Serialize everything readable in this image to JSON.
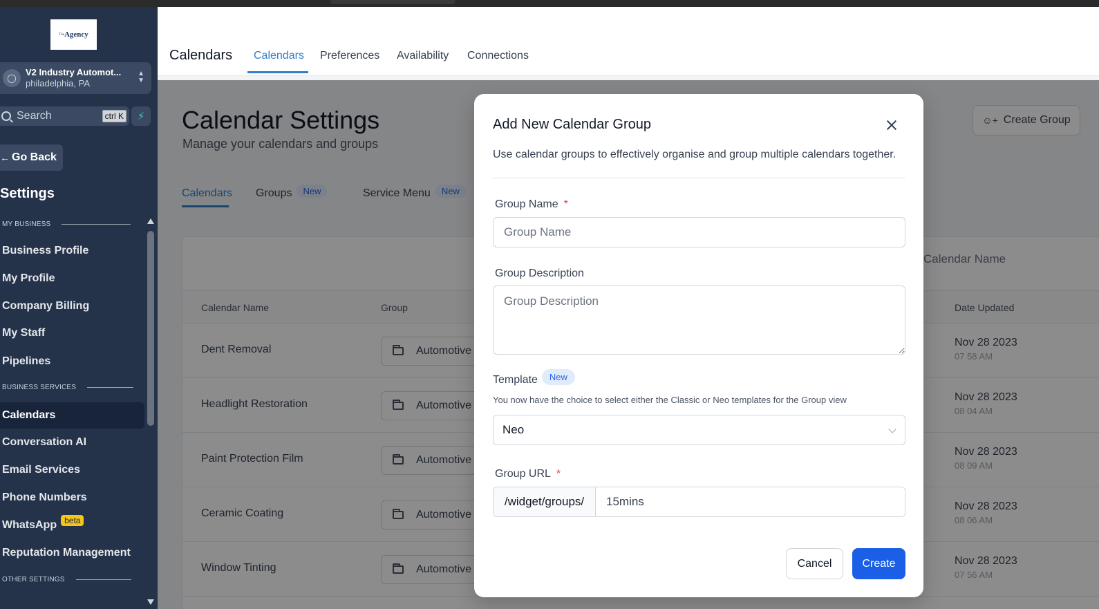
{
  "sidebar": {
    "logo_text": "Agency",
    "logo_super": "The",
    "location": {
      "name": "V2 Industry Automot...",
      "city": "philadelphia, PA"
    },
    "search": {
      "placeholder": "Search",
      "shortcut": "ctrl K"
    },
    "go_back": "Go Back",
    "title": "Settings",
    "sections": [
      {
        "label": "MY BUSINESS"
      },
      {
        "label": "BUSINESS SERVICES"
      },
      {
        "label": "OTHER SETTINGS"
      }
    ],
    "items": [
      {
        "label": "Business Profile"
      },
      {
        "label": "My Profile"
      },
      {
        "label": "Company Billing"
      },
      {
        "label": "My Staff"
      },
      {
        "label": "Pipelines"
      },
      {
        "label": "Calendars",
        "active": true
      },
      {
        "label": "Conversation AI"
      },
      {
        "label": "Email Services"
      },
      {
        "label": "Phone Numbers"
      },
      {
        "label": "WhatsApp",
        "badge": "beta"
      },
      {
        "label": "Reputation Management"
      }
    ]
  },
  "topbar": {
    "title": "Calendars",
    "tabs": [
      {
        "label": "Calendars",
        "active": true
      },
      {
        "label": "Preferences"
      },
      {
        "label": "Availability"
      },
      {
        "label": "Connections"
      }
    ]
  },
  "main": {
    "title": "Calendar Settings",
    "subtitle": "Manage your calendars and groups",
    "create_group": "Create Group",
    "tabs": [
      {
        "label": "Calendars",
        "active": true
      },
      {
        "label": "Groups",
        "badge": "New"
      },
      {
        "label": "Service Menu",
        "badge": "New"
      }
    ],
    "table": {
      "search_placeholder": "Calendar Name",
      "columns": [
        "Calendar Name",
        "Group",
        "Date Updated"
      ],
      "rows": [
        {
          "name": "Dent Removal",
          "group": "Automotive",
          "date": "Nov 28 2023",
          "time": "07 58 AM"
        },
        {
          "name": "Headlight Restoration",
          "group": "Automotive",
          "date": "Nov 28 2023",
          "time": "08 04 AM"
        },
        {
          "name": "Paint Protection Film",
          "group": "Automotive",
          "date": "Nov 28 2023",
          "time": "08 09 AM"
        },
        {
          "name": "Ceramic Coating",
          "group": "Automotive",
          "date": "Nov 28 2023",
          "time": "08 06 AM"
        },
        {
          "name": "Window Tinting",
          "group": "Automotive",
          "date": "Nov 28 2023",
          "time": "07 56 AM"
        }
      ]
    }
  },
  "modal": {
    "title": "Add New Calendar Group",
    "description": "Use calendar groups to effectively organise and group multiple calendars together.",
    "group_name": {
      "label": "Group Name",
      "required": "*",
      "placeholder": "Group Name",
      "value": ""
    },
    "group_description": {
      "label": "Group Description",
      "placeholder": "Group Description",
      "value": ""
    },
    "template": {
      "label": "Template",
      "badge": "New",
      "help": "You now have the choice to select either the Classic or Neo templates for the Group view",
      "selected": "Neo"
    },
    "group_url": {
      "label": "Group URL",
      "required": "*",
      "prefix": "/widget/groups/",
      "value": "15mins"
    },
    "cancel": "Cancel",
    "create": "Create"
  },
  "colors": {
    "sidebar_bg": "#24324a",
    "accent": "#2f80c9",
    "primary_button": "#1a5fe6",
    "required": "#ef4444",
    "beta_badge": "#f5c518"
  }
}
